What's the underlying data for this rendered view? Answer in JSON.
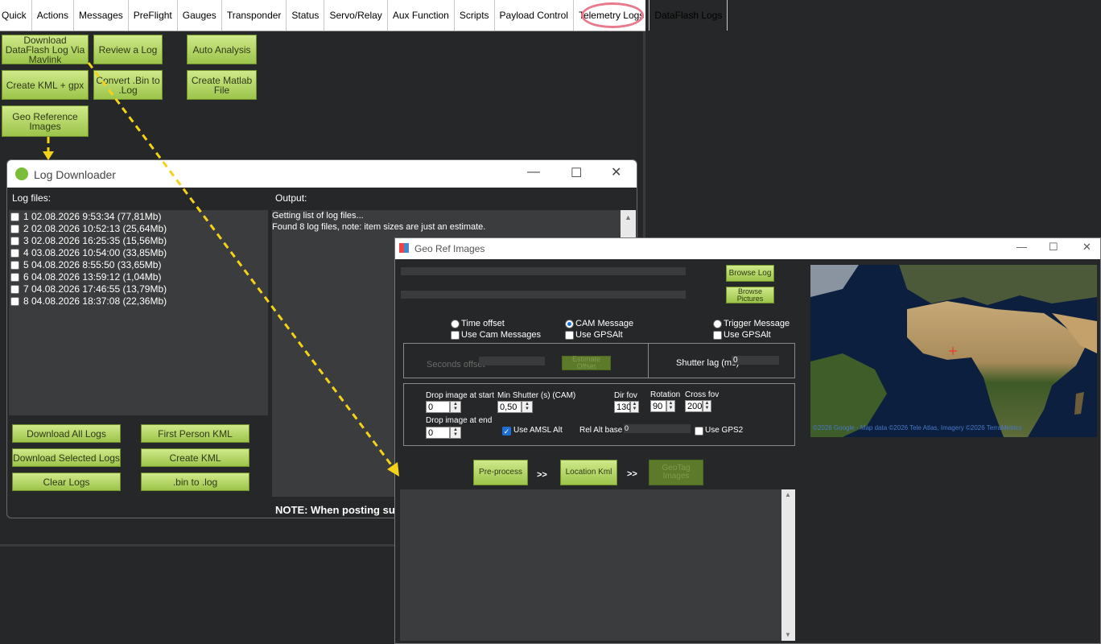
{
  "tabs": [
    "Quick",
    "Actions",
    "Messages",
    "PreFlight",
    "Gauges",
    "Transponder",
    "Status",
    "Servo/Relay",
    "Aux Function",
    "Scripts",
    "Payload Control",
    "Telemetry Logs",
    "DataFlash Logs"
  ],
  "dataflash_buttons": {
    "download_mavlink": "Download DataFlash Log Via Mavlink",
    "review_log": "Review a Log",
    "auto_analysis": "Auto Analysis",
    "create_kml_gpx": "Create KML + gpx",
    "convert_bin": "Convert .Bin to .Log",
    "create_matlab": "Create Matlab File",
    "geo_reference": "Geo Reference Images"
  },
  "log_downloader": {
    "title": "Log Downloader",
    "log_files_label": "Log files:",
    "output_label": "Output:",
    "files": [
      "1 02.08.2026 9:53:34  (77,81Mb)",
      "2 02.08.2026 10:52:13  (25,64Mb)",
      "3 02.08.2026 16:25:35  (15,56Mb)",
      "4 03.08.2026 10:54:00  (33,85Mb)",
      "5 04.08.2026 8:55:50  (33,65Mb)",
      "6 04.08.2026 13:59:12  (1,04Mb)",
      "7 04.08.2026 17:46:55  (13,79Mb)",
      "8 04.08.2026 18:37:08  (22,36Mb)"
    ],
    "output_lines": [
      "Getting list of log files...",
      "Found 8 log files, note: item sizes are just an estimate."
    ],
    "buttons": {
      "download_all": "Download All Logs",
      "download_selected": "Download Selected Logs",
      "clear": "Clear Logs",
      "first_person": "First Person KML",
      "create_kml": "Create KML",
      "bin_to_log": ".bin to .log"
    },
    "note": "NOTE: When posting su"
  },
  "georef": {
    "title": "Geo Ref Images",
    "browse_log": "Browse Log",
    "browse_pictures": "Browse Pictures",
    "radio": {
      "time_offset": "Time offset",
      "cam_message": "CAM Message",
      "trigger_message": "Trigger Message"
    },
    "checks": {
      "use_cam_messages": "Use Cam Messages",
      "use_gpsalt_1": "Use GPSAlt",
      "use_gpsalt_2": "Use GPSAlt",
      "use_amsl": "Use AMSL Alt",
      "use_gps2": "Use GPS2"
    },
    "seconds_offset": "Seconds offset",
    "estimate_offset": "Estimate Offset",
    "shutter_lag": "Shutter lag (ms)",
    "shutter_lag_value": "0",
    "drop_start": "Drop image at start",
    "drop_start_value": "0",
    "drop_end": "Drop image at end",
    "drop_end_value": "0",
    "min_shutter": "Min Shutter (s) (CAM)",
    "min_shutter_value": "0,50",
    "dir_fov": "Dir fov",
    "dir_fov_value": "130",
    "rotation": "Rotation",
    "rotation_value": "90",
    "cross_fov": "Cross fov",
    "cross_fov_value": "200",
    "rel_alt_base": "Rel Alt base",
    "rel_alt_value": "0",
    "preprocess": "Pre-process",
    "location_kml": "Location Kml",
    "geotag": "GeoTag Images",
    "arrow": ">>",
    "map_credit": "©2026 Google - Map data ©2026 Tele Atlas, Imagery ©2026 TerraMetrics"
  },
  "colors": {
    "green_btn": "#b5d86a",
    "highlight_circle": "#e87a8c",
    "arrow": "#f5d21a"
  }
}
